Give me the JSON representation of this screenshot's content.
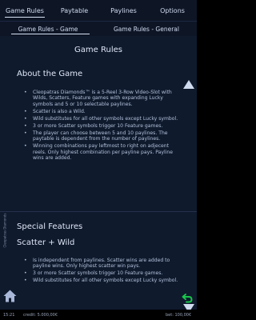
{
  "tabs": {
    "game_rules": "Game Rules",
    "paytable": "Paytable",
    "paylines": "Paylines",
    "options": "Options"
  },
  "subtabs": {
    "game": "Game Rules - Game",
    "general": "Game Rules - General"
  },
  "sidebar_label": "Cleopatras Diamonds",
  "content": {
    "heading": "Game Rules",
    "about_title": "About the Game",
    "about_bullets": [
      "Cleopatras Diamonds™ is a 5-Reel 3-Row Video-Slot with Wilds, Scatters, Feature games with expanding Lucky symbols and 5 or 10 selectable paylines.",
      "Scatter is also a Wild.",
      "Wild substitutes for all other symbols except Lucky symbol.",
      "3 or more Scatter symbols trigger 10 Feature games.",
      "The player can choose between 5 and 10 paylines. The paytable is dependent from the number of paylines.",
      "Winning combinations pay leftmost to right on adjecent reels. Only highest combination per payline pays. Payline wins are added."
    ],
    "special_title": "Special Features",
    "scatter_title": "Scatter + Wild",
    "scatter_bullets": [
      "Is independent from paylines. Scatter wins are added to payline wins. Only highest scatter win pays.",
      "3 or more Scatter symbols trigger 10 Feature games.",
      "Wild substitutes for all other symbols except Lucky symbol."
    ]
  },
  "status": {
    "time": "15:21",
    "credit": "credit: 5.000,00€",
    "bet": "bet: 100,00€"
  },
  "colors": {
    "content_bg": "#0f1a2d",
    "tab_bg": "#0e1626",
    "accent_green": "#19c44a"
  },
  "icons": {
    "home": "home-icon",
    "back": "back-arrow-icon",
    "scroll_up": "scroll-up-icon",
    "scroll_down": "scroll-down-icon"
  }
}
